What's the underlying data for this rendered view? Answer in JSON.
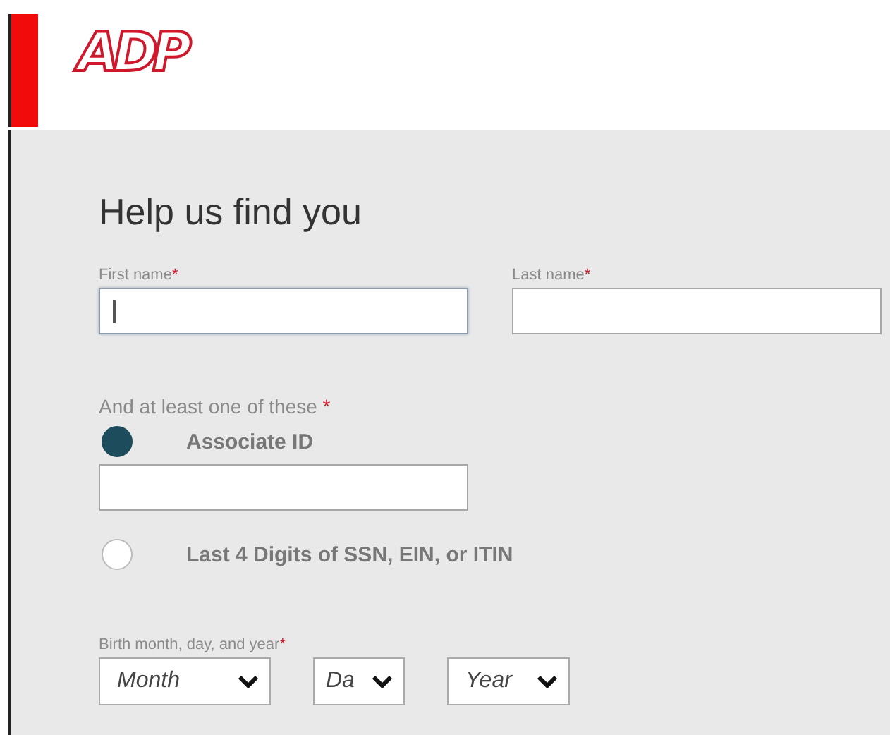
{
  "header": {
    "logo": "ADP"
  },
  "form": {
    "title": "Help us find you",
    "name_fields": [
      {
        "label": "First name",
        "required_mark": "*",
        "focused": true
      },
      {
        "label": "Last name",
        "required_mark": "*",
        "focused": false
      }
    ],
    "choice_prompt": "And at least one of these",
    "choice_required_mark": "*",
    "options": [
      {
        "label": "Associate ID",
        "selected": true,
        "has_field": true
      },
      {
        "label": "Last 4 Digits of SSN, EIN, or ITIN",
        "selected": false,
        "has_field": false
      }
    ],
    "birth_label": "Birth month, day, and year",
    "birth_required_mark": "*",
    "selects": [
      {
        "value": "Month"
      },
      {
        "value": "Da"
      },
      {
        "value": "Year"
      }
    ]
  }
}
